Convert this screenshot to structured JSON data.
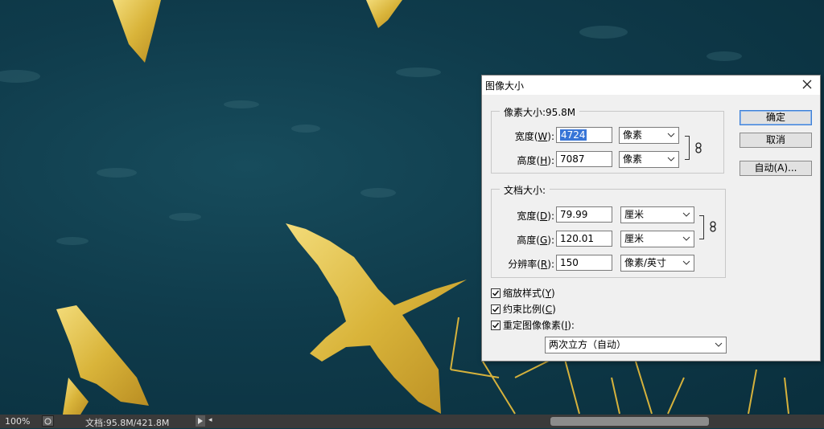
{
  "dialog": {
    "title": "图像大小",
    "pixel_dimensions": {
      "legend": "像素大小:95.8M",
      "width_label": "宽度",
      "width_key": "W",
      "width_value": "4724",
      "width_unit": "像素",
      "height_label": "高度",
      "height_key": "H",
      "height_value": "7087",
      "height_unit": "像素"
    },
    "document_size": {
      "legend": "文档大小:",
      "width_label": "宽度",
      "width_key": "D",
      "width_value": "79.99",
      "width_unit": "厘米",
      "height_label": "高度",
      "height_key": "G",
      "height_value": "120.01",
      "height_unit": "厘米",
      "resolution_label": "分辨率",
      "resolution_key": "R",
      "resolution_value": "150",
      "resolution_unit": "像素/英寸"
    },
    "options": {
      "scale_styles": "缩放样式",
      "scale_styles_key": "Y",
      "scale_styles_checked": true,
      "constrain": "约束比例",
      "constrain_key": "C",
      "constrain_checked": true,
      "resample": "重定图像像素",
      "resample_key": "I",
      "resample_checked": true,
      "resample_method": "两次立方（自动）"
    },
    "buttons": {
      "ok": "确定",
      "cancel": "取消",
      "auto": "自动(A)..."
    }
  },
  "statusbar": {
    "zoom": "100%",
    "doc_info": "文档:95.8M/421.8M"
  },
  "colors": {
    "canvas_bg": "#0f3b4b",
    "gold": "#e4c34a",
    "statusbar_bg": "#3a3a3a",
    "dialog_bg": "#f0f0f0",
    "selection": "#3875d7"
  }
}
